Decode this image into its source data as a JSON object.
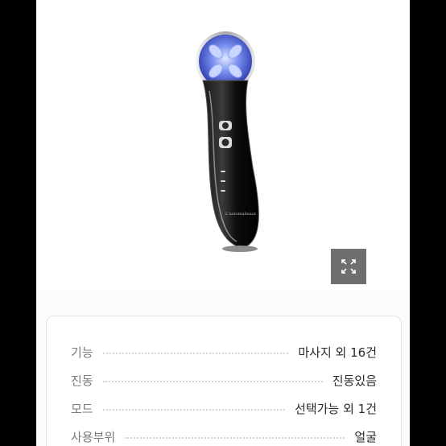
{
  "product": {
    "image_name": "face-massager-device",
    "brand_text": "L'automabeaut",
    "expand_icon": "expand-icon"
  },
  "specs": [
    {
      "label": "기능",
      "value": "마사지 외 16건"
    },
    {
      "label": "진동",
      "value": "진동있음"
    },
    {
      "label": "모드",
      "value": "선택가능 외 1건"
    },
    {
      "label": "사용부위",
      "value": "얼굴"
    }
  ],
  "colors": {
    "background": "#000000",
    "card_border": "#e2e2e2",
    "label_text": "#7a7a7a",
    "value_text": "#2a2a2a",
    "expand_button": "#6f6f6f"
  }
}
